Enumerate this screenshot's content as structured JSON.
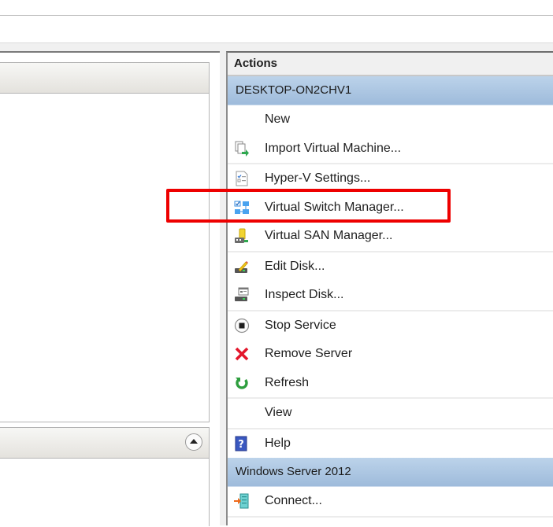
{
  "actions_pane": {
    "title": "Actions",
    "groups": [
      {
        "header": "DESKTOP-ON2CHV1",
        "items": [
          {
            "label": "New",
            "icon": "none"
          },
          {
            "label": "Import Virtual Machine...",
            "icon": "import-vm-icon"
          },
          {
            "label": "Hyper-V Settings...",
            "icon": "settings-document-icon"
          },
          {
            "label": "Virtual Switch Manager...",
            "icon": "network-switch-icon"
          },
          {
            "label": "Virtual SAN Manager...",
            "icon": "san-storage-icon"
          },
          {
            "label": "Edit Disk...",
            "icon": "edit-disk-icon"
          },
          {
            "label": "Inspect Disk...",
            "icon": "inspect-disk-icon"
          },
          {
            "label": "Stop Service",
            "icon": "stop-circle-icon"
          },
          {
            "label": "Remove Server",
            "icon": "red-x-icon"
          },
          {
            "label": "Refresh",
            "icon": "refresh-icon"
          },
          {
            "label": "View",
            "icon": "none"
          },
          {
            "label": "Help",
            "icon": "help-icon"
          }
        ]
      },
      {
        "header": "Windows Server 2012",
        "items": [
          {
            "label": "Connect...",
            "icon": "connect-icon"
          }
        ]
      }
    ]
  },
  "annotation": {
    "highlighted_item": "Virtual Switch Manager...",
    "color": "#ee0000"
  },
  "colors": {
    "group_header": "#b0c9e4",
    "pane_background": "#f0f0f0"
  }
}
